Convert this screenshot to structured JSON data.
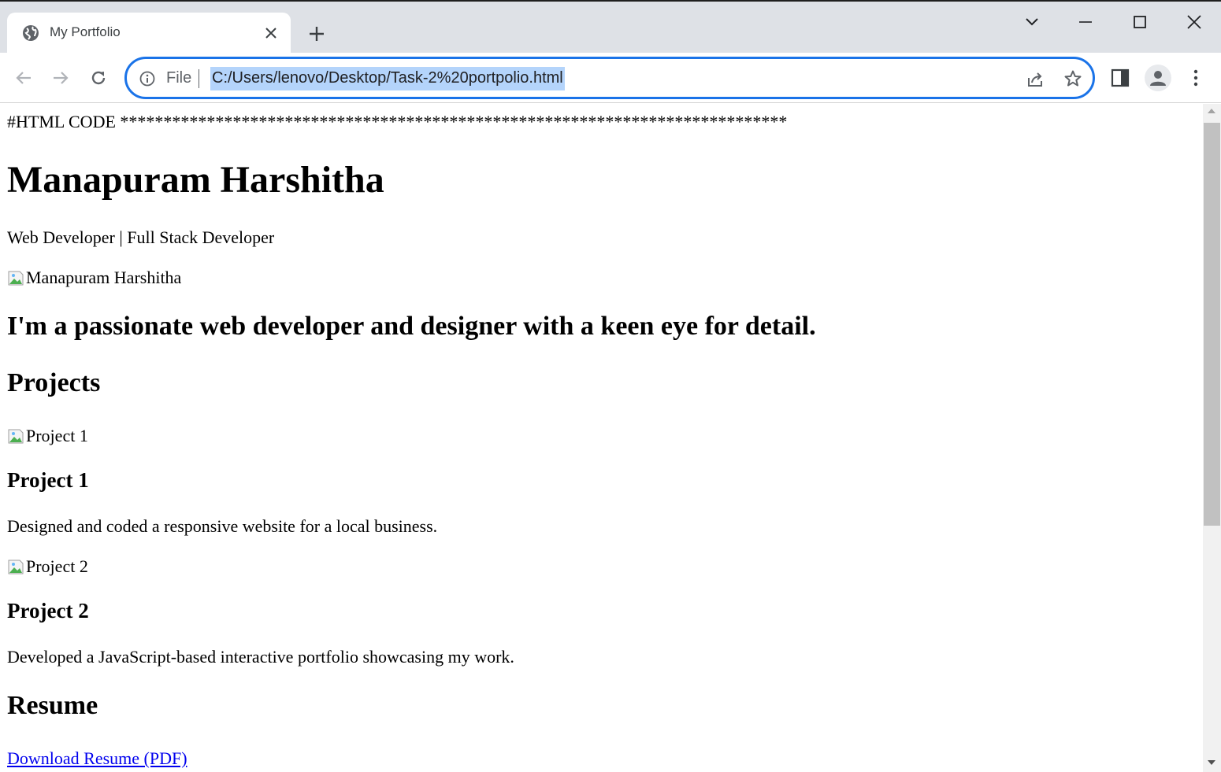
{
  "browser": {
    "tab": {
      "title": "My Portfolio",
      "favicon": "globe-icon"
    },
    "address_bar": {
      "scheme_label": "File",
      "url": "C:/Users/lenovo/Desktop/Task-2%20portpolio.html",
      "focus_ring_color": "#1a73e8",
      "selection_color": "#b4d4fb"
    },
    "icons": [
      "back-arrow-icon",
      "forward-arrow-icon",
      "reload-icon",
      "info-icon",
      "share-icon",
      "star-icon",
      "side-panel-icon",
      "profile-icon",
      "kebab-menu-icon",
      "tab-search-icon",
      "minimize-icon",
      "maximize-icon",
      "close-icon",
      "plus-icon"
    ]
  },
  "page": {
    "header_line": "#HTML CODE *****************************************************************************",
    "name": "Manapuram Harshitha",
    "role": "Web Developer | Full Stack Developer",
    "profile_image_alt": "Manapuram Harshitha",
    "tagline": "I'm a passionate web developer and designer with a keen eye for detail.",
    "projects_heading": "Projects",
    "projects": [
      {
        "image_alt": "Project 1",
        "title": "Project 1",
        "description": "Designed and coded a responsive website for a local business."
      },
      {
        "image_alt": "Project 2",
        "title": "Project 2",
        "description": "Developed a JavaScript-based interactive portfolio showcasing my work."
      }
    ],
    "resume_heading": "Resume",
    "resume_link": "Download Resume (PDF)",
    "link_color": "#0000ee"
  }
}
